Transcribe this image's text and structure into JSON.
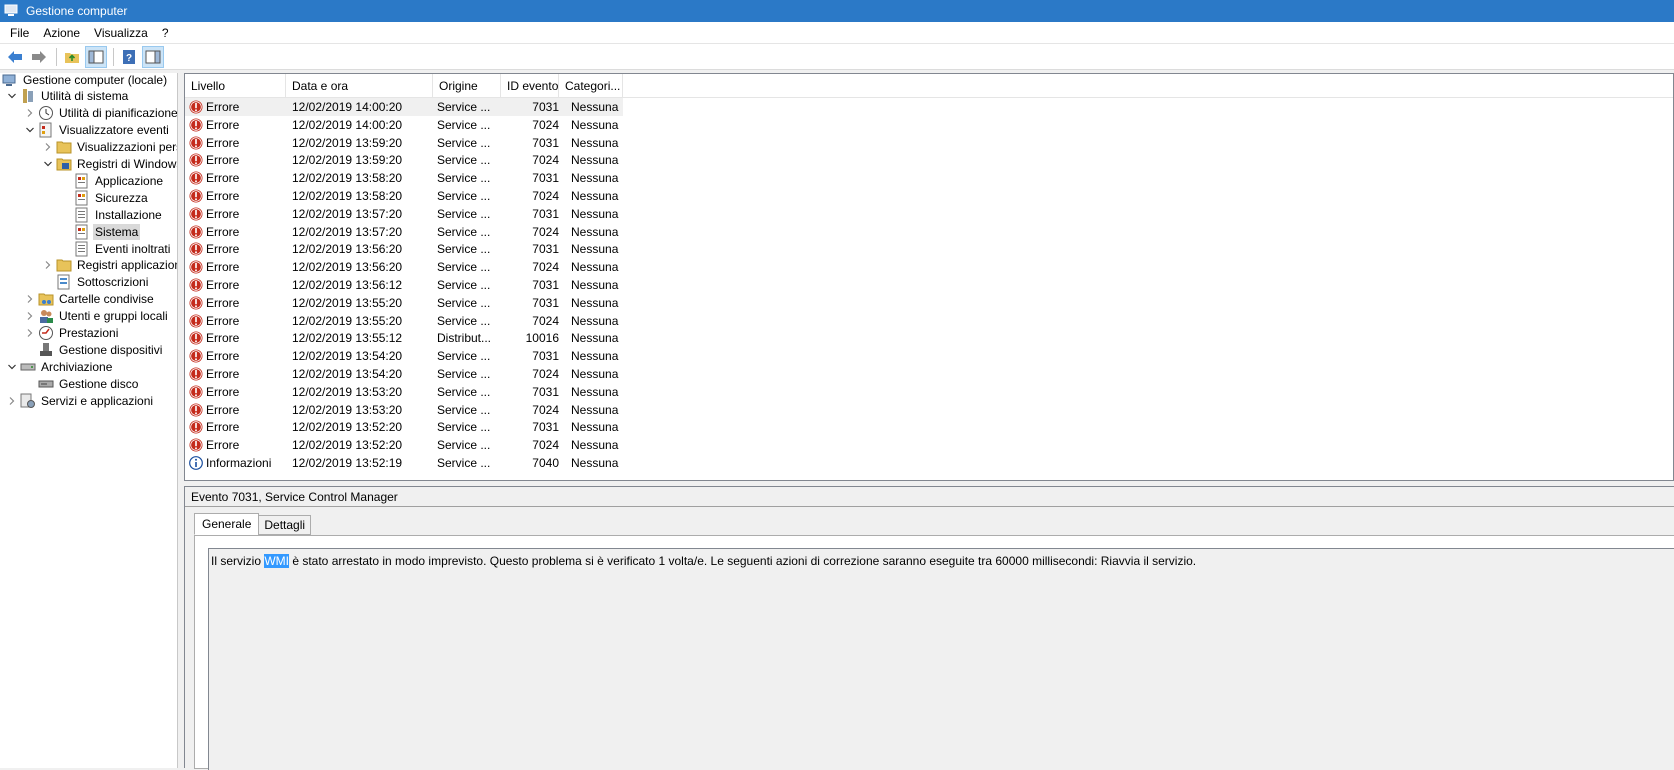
{
  "window": {
    "title": "Gestione computer"
  },
  "menu": [
    "File",
    "Azione",
    "Visualizza",
    "?"
  ],
  "toolbar": {
    "icons": [
      "back-arrow-icon",
      "forward-arrow-icon",
      "up-folder-icon",
      "show-hide-tree-icon",
      "help-icon",
      "action-pane-icon"
    ]
  },
  "tree": [
    {
      "label": "Gestione computer (locale)",
      "level": 0,
      "icon": "computer-management-icon",
      "expander": ""
    },
    {
      "label": "Utilità di sistema",
      "level": 1,
      "icon": "system-tools-icon",
      "expander": "open"
    },
    {
      "label": "Utilità di pianificazione",
      "level": 2,
      "icon": "clock-icon",
      "expander": "closed"
    },
    {
      "label": "Visualizzatore eventi",
      "level": 2,
      "icon": "event-viewer-icon",
      "expander": "open"
    },
    {
      "label": "Visualizzazioni personalizzate",
      "level": 3,
      "icon": "folder-icon",
      "expander": "closed"
    },
    {
      "label": "Registri di Windows",
      "level": 3,
      "icon": "folder-log-icon",
      "expander": "open"
    },
    {
      "label": "Applicazione",
      "level": 4,
      "icon": "log-icon",
      "expander": ""
    },
    {
      "label": "Sicurezza",
      "level": 4,
      "icon": "log-icon",
      "expander": ""
    },
    {
      "label": "Installazione",
      "level": 4,
      "icon": "log-plain-icon",
      "expander": ""
    },
    {
      "label": "Sistema",
      "level": 4,
      "icon": "log-icon",
      "expander": "",
      "selected": true
    },
    {
      "label": "Eventi inoltrati",
      "level": 4,
      "icon": "log-plain-icon",
      "expander": ""
    },
    {
      "label": "Registri applicazioni",
      "level": 3,
      "icon": "folder-icon",
      "expander": "closed"
    },
    {
      "label": "Sottoscrizioni",
      "level": 3,
      "icon": "subscriptions-icon",
      "expander": ""
    },
    {
      "label": "Cartelle condivise",
      "level": 2,
      "icon": "shared-folder-icon",
      "expander": "closed"
    },
    {
      "label": "Utenti e gruppi locali",
      "level": 2,
      "icon": "users-icon",
      "expander": "closed"
    },
    {
      "label": "Prestazioni",
      "level": 2,
      "icon": "performance-icon",
      "expander": "closed"
    },
    {
      "label": "Gestione dispositivi",
      "level": 2,
      "icon": "device-manager-icon",
      "expander": ""
    },
    {
      "label": "Archiviazione",
      "level": 1,
      "icon": "storage-icon",
      "expander": "open"
    },
    {
      "label": "Gestione disco",
      "level": 2,
      "icon": "disk-icon",
      "expander": ""
    },
    {
      "label": "Servizi e applicazioni",
      "level": 1,
      "icon": "services-icon",
      "expander": "closed"
    }
  ],
  "columns": [
    "Livello",
    "Data e ora",
    "Origine",
    "ID evento",
    "Categori..."
  ],
  "events": [
    {
      "level": "Errore",
      "type": "error",
      "date": "12/02/2019 14:00:20",
      "source": "Service ...",
      "id": "7031",
      "category": "Nessuna",
      "selected": true
    },
    {
      "level": "Errore",
      "type": "error",
      "date": "12/02/2019 14:00:20",
      "source": "Service ...",
      "id": "7024",
      "category": "Nessuna"
    },
    {
      "level": "Errore",
      "type": "error",
      "date": "12/02/2019 13:59:20",
      "source": "Service ...",
      "id": "7031",
      "category": "Nessuna"
    },
    {
      "level": "Errore",
      "type": "error",
      "date": "12/02/2019 13:59:20",
      "source": "Service ...",
      "id": "7024",
      "category": "Nessuna"
    },
    {
      "level": "Errore",
      "type": "error",
      "date": "12/02/2019 13:58:20",
      "source": "Service ...",
      "id": "7031",
      "category": "Nessuna"
    },
    {
      "level": "Errore",
      "type": "error",
      "date": "12/02/2019 13:58:20",
      "source": "Service ...",
      "id": "7024",
      "category": "Nessuna"
    },
    {
      "level": "Errore",
      "type": "error",
      "date": "12/02/2019 13:57:20",
      "source": "Service ...",
      "id": "7031",
      "category": "Nessuna"
    },
    {
      "level": "Errore",
      "type": "error",
      "date": "12/02/2019 13:57:20",
      "source": "Service ...",
      "id": "7024",
      "category": "Nessuna"
    },
    {
      "level": "Errore",
      "type": "error",
      "date": "12/02/2019 13:56:20",
      "source": "Service ...",
      "id": "7031",
      "category": "Nessuna"
    },
    {
      "level": "Errore",
      "type": "error",
      "date": "12/02/2019 13:56:20",
      "source": "Service ...",
      "id": "7024",
      "category": "Nessuna"
    },
    {
      "level": "Errore",
      "type": "error",
      "date": "12/02/2019 13:56:12",
      "source": "Service ...",
      "id": "7031",
      "category": "Nessuna"
    },
    {
      "level": "Errore",
      "type": "error",
      "date": "12/02/2019 13:55:20",
      "source": "Service ...",
      "id": "7031",
      "category": "Nessuna"
    },
    {
      "level": "Errore",
      "type": "error",
      "date": "12/02/2019 13:55:20",
      "source": "Service ...",
      "id": "7024",
      "category": "Nessuna"
    },
    {
      "level": "Errore",
      "type": "error",
      "date": "12/02/2019 13:55:12",
      "source": "Distribut...",
      "id": "10016",
      "category": "Nessuna"
    },
    {
      "level": "Errore",
      "type": "error",
      "date": "12/02/2019 13:54:20",
      "source": "Service ...",
      "id": "7031",
      "category": "Nessuna"
    },
    {
      "level": "Errore",
      "type": "error",
      "date": "12/02/2019 13:54:20",
      "source": "Service ...",
      "id": "7024",
      "category": "Nessuna"
    },
    {
      "level": "Errore",
      "type": "error",
      "date": "12/02/2019 13:53:20",
      "source": "Service ...",
      "id": "7031",
      "category": "Nessuna"
    },
    {
      "level": "Errore",
      "type": "error",
      "date": "12/02/2019 13:53:20",
      "source": "Service ...",
      "id": "7024",
      "category": "Nessuna"
    },
    {
      "level": "Errore",
      "type": "error",
      "date": "12/02/2019 13:52:20",
      "source": "Service ...",
      "id": "7031",
      "category": "Nessuna"
    },
    {
      "level": "Errore",
      "type": "error",
      "date": "12/02/2019 13:52:20",
      "source": "Service ...",
      "id": "7024",
      "category": "Nessuna"
    },
    {
      "level": "Informazioni",
      "type": "info",
      "date": "12/02/2019 13:52:19",
      "source": "Service ...",
      "id": "7040",
      "category": "Nessuna"
    }
  ],
  "detail": {
    "title": "Evento 7031, Service Control Manager",
    "tabs": [
      "Generale",
      "Dettagli"
    ],
    "text_before": "Il servizio ",
    "highlight": "WMI",
    "text_after": " è stato arrestato in modo imprevisto. Questo problema si è verificato 1 volta/e. Le seguenti azioni di correzione saranno eseguite tra 60000 millisecondi: Riavvia il servizio."
  },
  "colors": {
    "titlebar": "#2b79c7",
    "error": "#c42b1c",
    "info": "#1a4e9f",
    "selection": "#3399ff"
  }
}
